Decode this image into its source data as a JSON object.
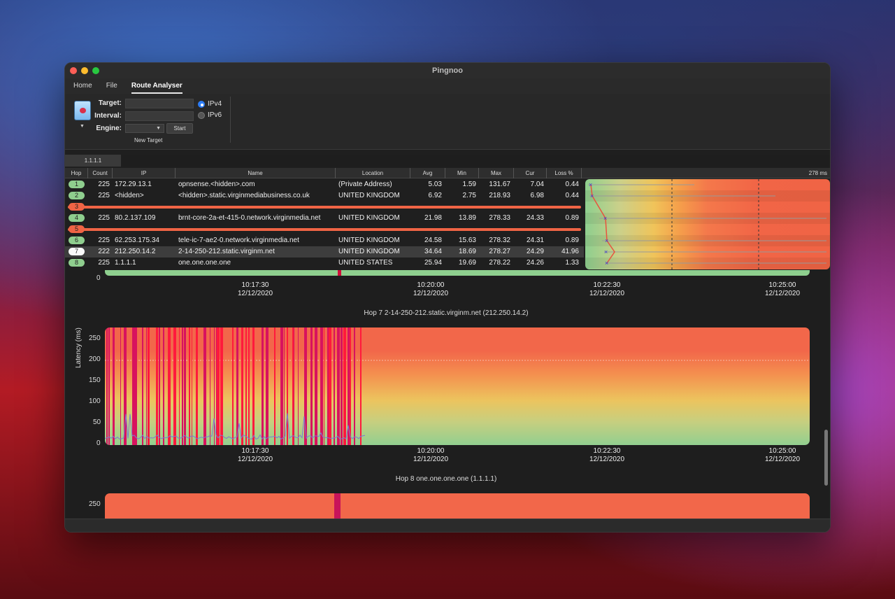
{
  "window": {
    "title": "Pingnoo"
  },
  "menu": {
    "items": [
      "Home",
      "File",
      "Route Analyser"
    ],
    "active_index": 2
  },
  "ribbon": {
    "target_label": "Target:",
    "interval_label": "Interval:",
    "engine_label": "Engine:",
    "start_label": "Start",
    "ipv4_label": "IPv4",
    "ipv6_label": "IPv6",
    "ipv4_selected": true,
    "group_caption": "New Target",
    "icon": "document-target-icon"
  },
  "tabs": [
    "1.1.1.1"
  ],
  "table": {
    "columns": [
      "Hop",
      "Count",
      "IP",
      "Name",
      "Location",
      "Avg",
      "Min",
      "Max",
      "Cur",
      "Loss %"
    ],
    "graph_scale_label": "278 ms",
    "rows": [
      {
        "hop": "1",
        "count": "225",
        "ip": "172.29.13.1",
        "name": "opnsense.<hidden>.com",
        "location": "(Private Address)",
        "avg": "5.03",
        "min": "1.59",
        "max": "131.67",
        "cur": "7.04",
        "loss": "0.44"
      },
      {
        "hop": "2",
        "count": "225",
        "ip": "<hidden>",
        "name": "<hidden>.static.virginmediabusiness.co.uk",
        "location": "UNITED KINGDOM",
        "avg": "6.92",
        "min": "2.75",
        "max": "218.93",
        "cur": "6.98",
        "loss": "0.44"
      },
      {
        "hop": "3",
        "timeout": true
      },
      {
        "hop": "4",
        "count": "225",
        "ip": "80.2.137.109",
        "name": "brnt-core-2a-et-415-0.network.virginmedia.net",
        "location": "UNITED KINGDOM",
        "avg": "21.98",
        "min": "13.89",
        "max": "278.33",
        "cur": "24.33",
        "loss": "0.89"
      },
      {
        "hop": "5",
        "timeout": true
      },
      {
        "hop": "6",
        "count": "225",
        "ip": "62.253.175.34",
        "name": "tele-ic-7-ae2-0.network.virginmedia.net",
        "location": "UNITED KINGDOM",
        "avg": "24.58",
        "min": "15.63",
        "max": "278.32",
        "cur": "24.31",
        "loss": "0.89"
      },
      {
        "hop": "7",
        "count": "222",
        "ip": "212.250.14.2",
        "name": "2-14-250-212.static.virginm.net",
        "location": "UNITED KINGDOM",
        "avg": "34.64",
        "min": "18.69",
        "max": "278.27",
        "cur": "24.29",
        "loss": "41.96",
        "selected": true
      },
      {
        "hop": "8",
        "count": "225",
        "ip": "1.1.1.1",
        "name": "one.one.one.one",
        "location": "UNITED STATES",
        "avg": "25.94",
        "min": "19.69",
        "max": "278.22",
        "cur": "24.26",
        "loss": "1.33"
      }
    ]
  },
  "charts": {
    "top_partial": {
      "y_tick": "0",
      "time_labels": [
        {
          "time": "10:17:30",
          "date": "12/12/2020"
        },
        {
          "time": "10:20:00",
          "date": "12/12/2020"
        },
        {
          "time": "10:22:30",
          "date": "12/12/2020"
        },
        {
          "time": "10:25:00",
          "date": "12/12/2020"
        }
      ]
    },
    "hop7": {
      "title": "Hop 7 2-14-250-212.static.virginm.net (212.250.14.2)",
      "ylabel": "Latency (ms)",
      "y_ticks": [
        "250",
        "200",
        "150",
        "100",
        "50",
        "0"
      ],
      "time_labels": [
        {
          "time": "10:17:30",
          "date": "12/12/2020"
        },
        {
          "time": "10:20:00",
          "date": "12/12/2020"
        },
        {
          "time": "10:22:30",
          "date": "12/12/2020"
        },
        {
          "time": "10:25:00",
          "date": "12/12/2020"
        }
      ]
    },
    "hop8": {
      "title": "Hop 8 one.one.one.one (1.1.1.1)",
      "y_ticks": [
        "250"
      ]
    }
  },
  "chart_data": {
    "type": "line",
    "title": "Hop 7 2-14-250-212.static.virginm.net (212.250.14.2)",
    "xlabel": "",
    "ylabel": "Latency (ms)",
    "ylim": [
      0,
      278
    ],
    "x": [
      "10:17:30",
      "10:20:00",
      "10:22:30",
      "10:25:00"
    ],
    "series": [
      {
        "values": [
          20,
          18,
          22,
          19
        ]
      }
    ]
  }
}
